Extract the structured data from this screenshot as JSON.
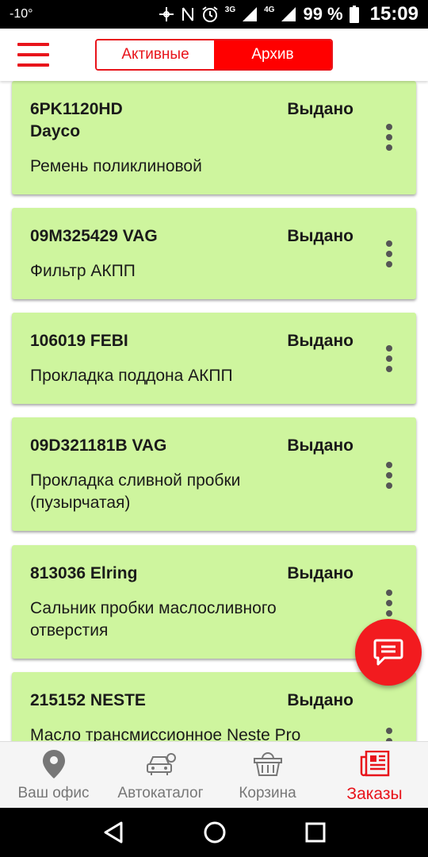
{
  "statusbar": {
    "temperature": "-10°",
    "signal_3g": "3G",
    "signal_4g": "4G",
    "battery": "99 %",
    "time": "15:09"
  },
  "header": {
    "tabs": [
      {
        "label": "Активные",
        "active": false
      },
      {
        "label": "Архив",
        "active": true
      }
    ]
  },
  "orders": [
    {
      "code": "6PK1120HD",
      "brand": "Dayco",
      "status": "Выдано",
      "description": "Ремень поликлиновой"
    },
    {
      "code": "09M325429 VAG",
      "status": "Выдано",
      "description": "Фильтр АКПП"
    },
    {
      "code": "106019 FEBI",
      "status": "Выдано",
      "description": "Прокладка поддона АКПП"
    },
    {
      "code": "09D321181B VAG",
      "status": "Выдано",
      "description": "Прокладка сливной пробки",
      "description2": "(пузырчатая)"
    },
    {
      "code": "813036 Elring",
      "status": "Выдано",
      "description": "Сальник пробки маслосливного",
      "description2": "отверстия"
    },
    {
      "code": "215152 NESTE",
      "status": "Выдано",
      "description": "Масло трансмиссионное Neste Pro"
    }
  ],
  "bottom_nav": [
    {
      "label": "Ваш офис",
      "icon": "location-pin-icon"
    },
    {
      "label": "Автокаталог",
      "icon": "car-catalog-icon"
    },
    {
      "label": "Корзина",
      "icon": "basket-icon"
    },
    {
      "label": "Заказы",
      "icon": "orders-icon",
      "active": true
    }
  ],
  "colors": {
    "accent": "#e8141b",
    "card": "#cef59e",
    "fab": "#f21b1f"
  }
}
